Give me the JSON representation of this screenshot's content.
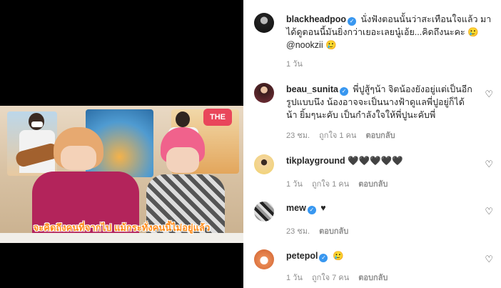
{
  "video": {
    "badge": "THE",
    "subtitle": "จะคิดถึงคนที่จากไป แม้กระทั่งคนนี้ไม่อยู่แล้ว"
  },
  "comments": [
    {
      "username": "blackheadpoo",
      "verified": true,
      "text": "นั่งฟังตอนนั้นว่าสะเทือนใจแล้ว มาได้ดูตอนนี้มันยิ่งกว่าเยอะเลยนู๋เอ้ย...คิดถึงนะคะ 🥲 @nookzii 🥲",
      "time": "1 วัน",
      "likes": "",
      "reply": ""
    },
    {
      "username": "beau_sunita",
      "verified": true,
      "text": "พี่ปูสู้ๆน้า จิตน้องยังอยู่แต่เป็นอีกรูปแบบนึง น้องอาจจะเป็นนางฟ้าดูแลพี่ปูอยู่ก็ได้น้า ยิ้มๆนะคับ เป็นกำลังใจให้พี่ปูนะคับพี่",
      "time": "23 ชม.",
      "likes": "ถูกใจ 1 คน",
      "reply": "ตอบกลับ"
    },
    {
      "username": "tikplayground",
      "verified": false,
      "text": "🖤🖤🖤🖤🖤",
      "time": "1 วัน",
      "likes": "ถูกใจ 1 คน",
      "reply": "ตอบกลับ"
    },
    {
      "username": "mew",
      "verified": true,
      "text": "♥",
      "time": "23 ชม.",
      "likes": "",
      "reply": "ตอบกลับ"
    },
    {
      "username": "petepol",
      "verified": true,
      "text": "🥲",
      "time": "1 วัน",
      "likes": "ถูกใจ 7 คน",
      "reply": "ตอบกลับ"
    }
  ],
  "colors": {
    "verified": "#3897f0",
    "subtitle": "#ff8c1a",
    "meta": "#8e8e8e"
  },
  "icons": {
    "like": "heart-outline-icon",
    "verified": "verified-badge-icon"
  }
}
